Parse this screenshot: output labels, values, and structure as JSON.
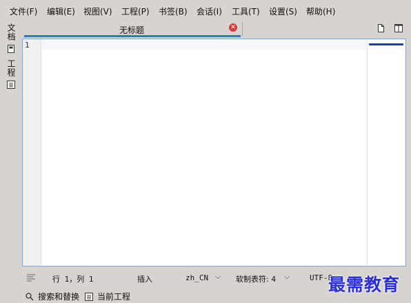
{
  "menu": {
    "items": [
      "文件(F)",
      "编辑(E)",
      "视图(V)",
      "工程(P)",
      "书签(B)",
      "会话(I)",
      "工具(T)",
      "设置(S)",
      "帮助(H)"
    ]
  },
  "sidebar": {
    "documents": "文档",
    "projects": "工程"
  },
  "tabs": {
    "active": "无标题"
  },
  "editor": {
    "line_number": "1"
  },
  "statusbar": {
    "position": "行 1，列 1",
    "mode": "插入",
    "language": "zh_CN",
    "indent": "软制表符: 4",
    "encoding": "UTF-8"
  },
  "bottom": {
    "search": "搜索和替换",
    "current_project": "当前工程"
  },
  "watermark": "最需教育"
}
